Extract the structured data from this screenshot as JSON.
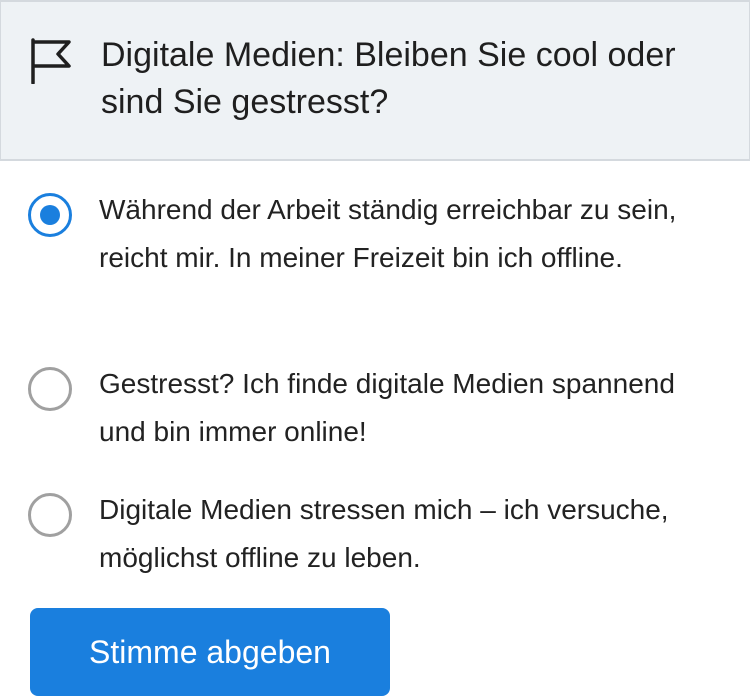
{
  "poll": {
    "title": "Digitale Medien: Bleiben Sie cool oder sind Sie gestresst?",
    "header_icon": "flag-icon",
    "options": [
      {
        "label": "Während der Arbeit ständig erreichbar zu sein, reicht mir. In meiner Freizeit bin ich offline.",
        "selected": true
      },
      {
        "label": "Gestresst? Ich finde digitale Medien spannend und bin immer online!",
        "selected": false
      },
      {
        "label": "Digitale Medien stressen mich – ich versuche, möglichst offline zu leben.",
        "selected": false
      }
    ],
    "submit_label": "Stimme abgeben"
  },
  "colors": {
    "accent": "#1a7fde",
    "header_background": "#eef2f5",
    "radio_unchecked": "#a0a0a0"
  }
}
